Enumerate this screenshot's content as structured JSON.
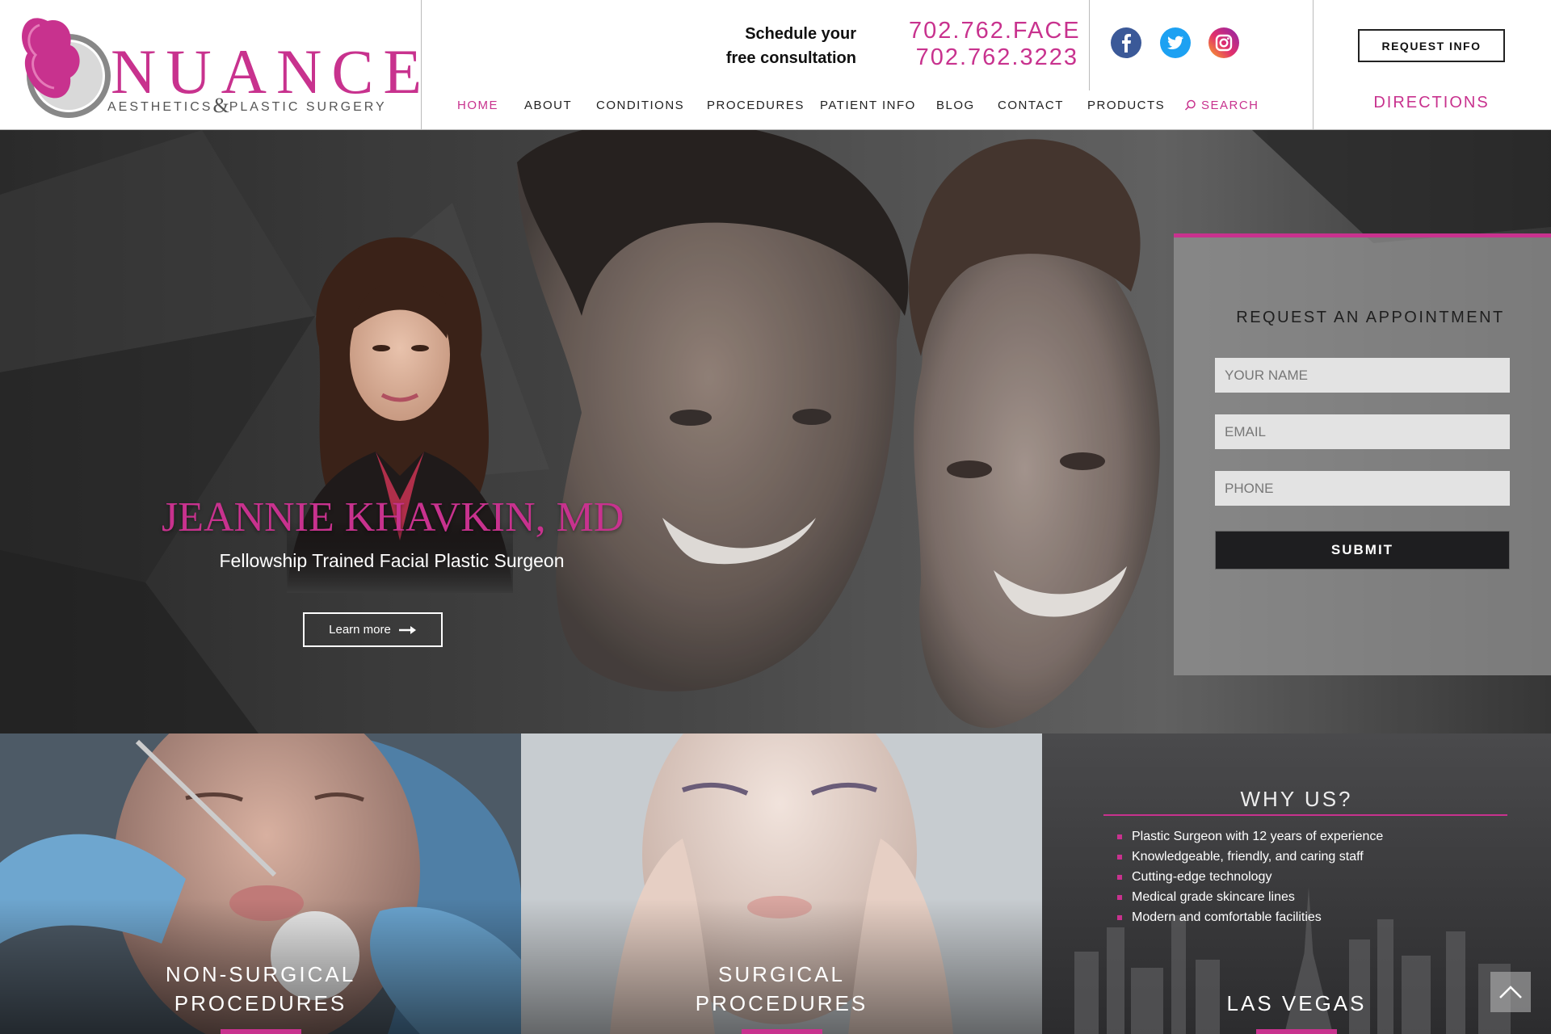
{
  "brand": {
    "name": "NUANCE",
    "sub_left": "AESTHETICS",
    "amp": "&",
    "sub_right": "PLASTIC SURGERY"
  },
  "header": {
    "schedule_line1": "Schedule your",
    "schedule_line2": "free consultation",
    "phone_vanity": "702.762.FACE",
    "phone_number": "702.762.3223",
    "request_info": "REQUEST INFO",
    "directions": "DIRECTIONS",
    "social": [
      {
        "name": "facebook-icon",
        "color": "#3b5998"
      },
      {
        "name": "twitter-icon",
        "color": "#1da1f2"
      },
      {
        "name": "instagram-icon",
        "color": "#e1306c"
      }
    ]
  },
  "nav": {
    "items": [
      {
        "label": "HOME",
        "active": true
      },
      {
        "label": "ABOUT"
      },
      {
        "label": "CONDITIONS"
      },
      {
        "label": "PROCEDURES"
      },
      {
        "label": "PATIENT INFO"
      },
      {
        "label": "BLOG"
      },
      {
        "label": "CONTACT"
      },
      {
        "label": "PRODUCTS"
      }
    ],
    "search_label": "SEARCH"
  },
  "hero": {
    "doctor_name": "JEANNIE KHAVKIN, MD",
    "doctor_title": "Fellowship Trained Facial Plastic Surgeon",
    "learn_more": "Learn more"
  },
  "form": {
    "title": "REQUEST AN APPOINTMENT",
    "name_placeholder": "YOUR NAME",
    "email_placeholder": "EMAIL",
    "phone_placeholder": "PHONE",
    "submit": "SUBMIT"
  },
  "tiles": {
    "non_surgical": {
      "line1": "NON-SURGICAL",
      "line2": "PROCEDURES"
    },
    "surgical": {
      "line1": "SURGICAL",
      "line2": "PROCEDURES"
    },
    "why": {
      "title": "WHY US?",
      "points": [
        "Plastic Surgeon with 12 years of experience",
        "Knowledgeable, friendly, and caring staff",
        "Cutting-edge technology",
        "Medical grade skincare lines",
        "Modern and comfortable facilities"
      ],
      "location": "LAS VEGAS"
    }
  },
  "colors": {
    "accent": "#c8328e",
    "dark": "#1e1e20"
  }
}
